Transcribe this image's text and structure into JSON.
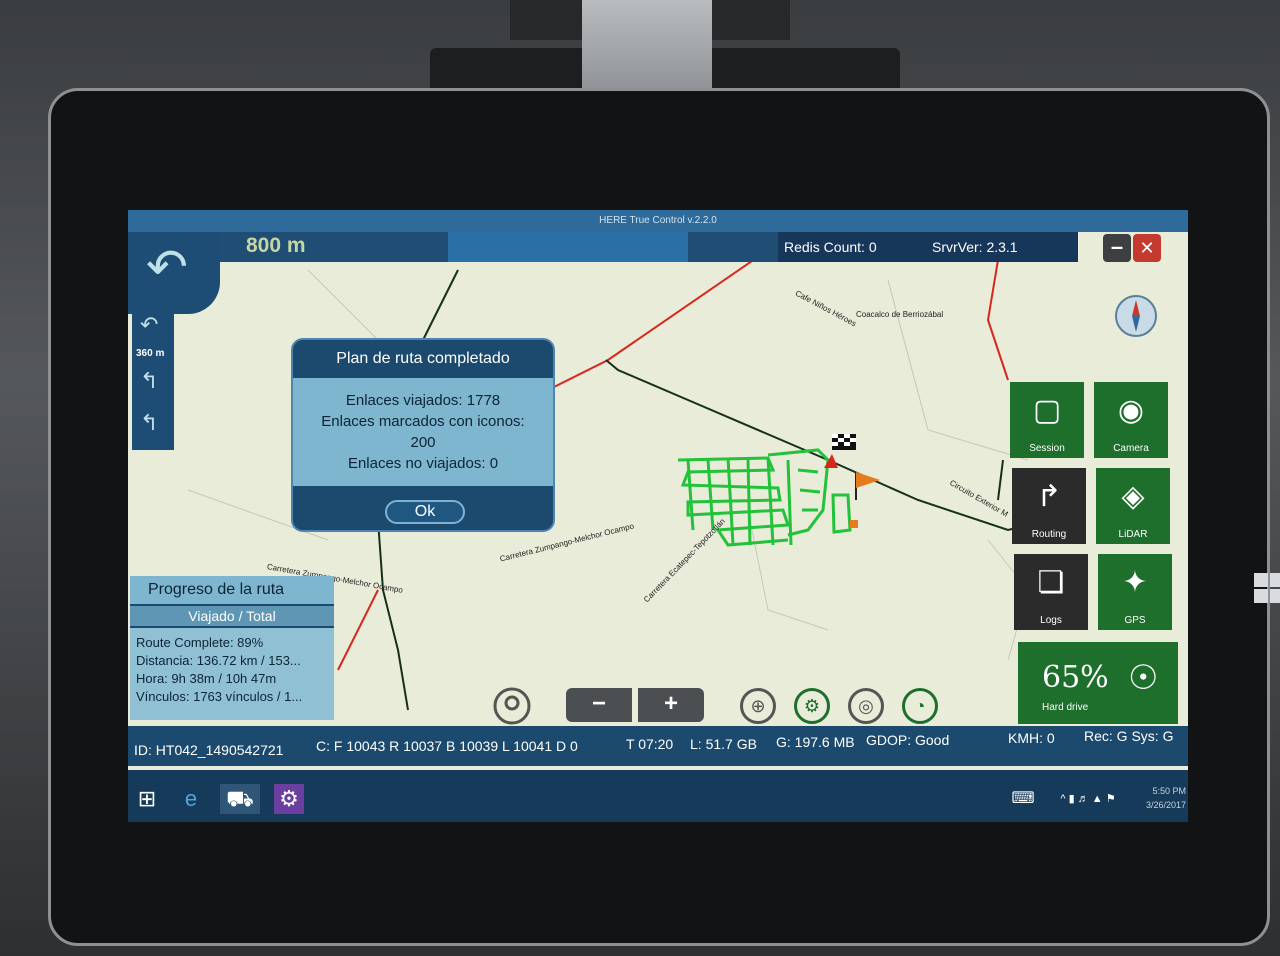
{
  "app": {
    "title": "HERE True Control v.2.2.0"
  },
  "nav": {
    "distance": "800 m",
    "next_distance": "360 m",
    "redis_count": "Redis Count: 0",
    "server_version": "SrvrVer: 2.3.1",
    "min_label": "–",
    "close_label": "✕"
  },
  "dialog": {
    "title": "Plan de ruta completado",
    "line1": "Enlaces viajados: 1778",
    "line2": "Enlaces marcados con iconos:",
    "line3": "200",
    "line4": "Enlaces no viajados: 0",
    "ok_label": "Ok"
  },
  "progress": {
    "title": "Progreso de la ruta",
    "subtitle": "Viajado / Total",
    "route_complete": "Route Complete: 89%",
    "distance": "Distancia: 136.72 km / 153...",
    "time": "Hora: 9h 38m / 10h 47m",
    "links": "Vínculos: 1763 vínculos / 1..."
  },
  "map_labels": {
    "l1": "Cafe Niños Héroes",
    "l2": "Coacalco de Berriozábal",
    "l3": "Carretera Zumpango-Melchor Ocampo",
    "l4": "Carretera Ecatepec-Tepotzotlán",
    "l5": "Carretera Zumpango-Melchor Ocampo",
    "l6": "Circuito Exterior M"
  },
  "tiles": {
    "session": "Session",
    "camera": "Camera",
    "routing": "Routing",
    "lidar": "LiDAR",
    "logs": "Logs",
    "gps": "GPS",
    "hdd_percent": "65%",
    "hdd_label": "Hard drive"
  },
  "tools": {
    "zoom_out": "−",
    "zoom_in": "+"
  },
  "status": {
    "id": "ID: HT042_1490542721",
    "counters": "C: F 10043 R 10037 B 10039 L 10041 D 0",
    "time": "T 07:20",
    "local": "L:  51.7 GB",
    "gps": "G: 197.6 MB",
    "gdop": "GDOP: Good",
    "kmh": "KMH: 0",
    "rec": "Rec: G  Sys: G"
  },
  "taskbar": {
    "clock_time": "5:50 PM",
    "clock_date": "3/26/2017"
  },
  "colors": {
    "panel_blue": "#1b4a6e",
    "tile_green": "#1e6e2c",
    "track_green": "#22c23a",
    "map_bg": "#e9ecd8",
    "road_red": "#d8261c"
  }
}
